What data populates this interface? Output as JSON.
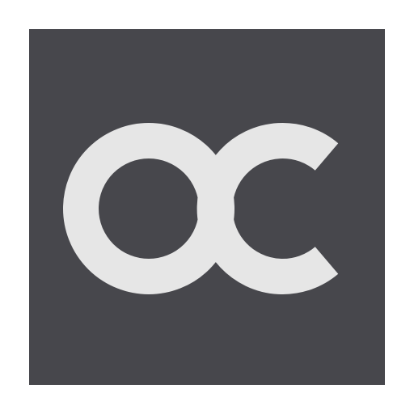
{
  "logo": {
    "text": "oc",
    "background_color": "#47474c",
    "glyph_color": "#e6e6e6",
    "page_background": "#ffffff"
  }
}
